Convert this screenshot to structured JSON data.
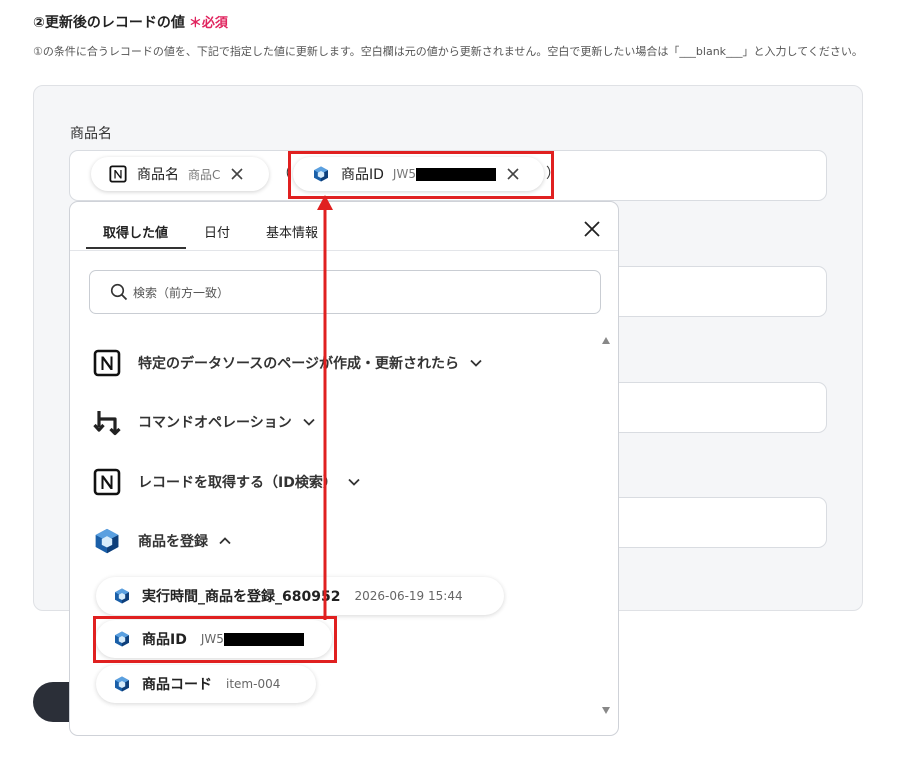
{
  "section": {
    "title": "②更新後のレコードの値",
    "required_mark": "＊",
    "required_label": "必須",
    "description": "①の条件に合うレコードの値を、下記で指定した値に更新します。空白欄は元の値から更新されません。空白で更新したい場合は「___blank___」と入力してください。"
  },
  "field": {
    "label": "商品名",
    "chips": [
      {
        "name": "商品名",
        "value": "商品C",
        "icon": "notion-icon"
      },
      {
        "name": "商品ID",
        "value": "JW5",
        "icon": "cube-icon"
      }
    ],
    "open_paren": "（",
    "close_paren": "）"
  },
  "dropdown": {
    "tabs": [
      "取得した値",
      "日付",
      "基本情報"
    ],
    "active_tab": "取得した値",
    "search_placeholder": "検索（前方一致）",
    "groups": [
      {
        "label": "特定のデータソースのページが作成・更新されたら",
        "icon": "notion-icon",
        "expanded": false
      },
      {
        "label": "コマンドオペレーション",
        "icon": "command-operation-icon",
        "expanded": false
      },
      {
        "label": "レコードを取得する（ID検索）",
        "icon": "notion-icon",
        "expanded": false
      },
      {
        "label": "商品を登録",
        "icon": "cube-icon",
        "expanded": true
      }
    ],
    "values": [
      {
        "name": "実行時間_商品を登録_680952",
        "value": "2026-06-19 15:44"
      },
      {
        "name": "商品ID",
        "value": "JW5"
      },
      {
        "name": "商品コード",
        "value": "item-004"
      }
    ]
  },
  "colors": {
    "accent_red": "#e02020",
    "required_pink": "#e0245e",
    "cube_blue": "#1a5fa8"
  }
}
